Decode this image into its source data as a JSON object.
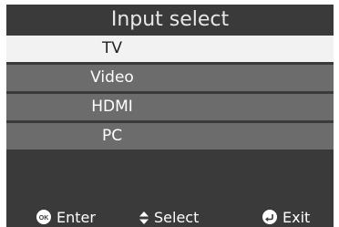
{
  "menu": {
    "title": "Input select",
    "items": [
      {
        "label": "TV",
        "selected": true
      },
      {
        "label": "Video",
        "selected": false
      },
      {
        "label": "HDMI",
        "selected": false
      },
      {
        "label": "PC",
        "selected": false
      }
    ]
  },
  "footer": {
    "enter": {
      "icon": "ok-button-icon",
      "badge": "OK",
      "label": "Enter"
    },
    "select": {
      "icon": "up-down-arrows-icon",
      "label": "Select"
    },
    "exit": {
      "icon": "return-icon",
      "label": "Exit"
    }
  },
  "colors": {
    "panel": "#3a3a3a",
    "item": "#6c6c6c",
    "selected_item": "#f2f2f2"
  }
}
